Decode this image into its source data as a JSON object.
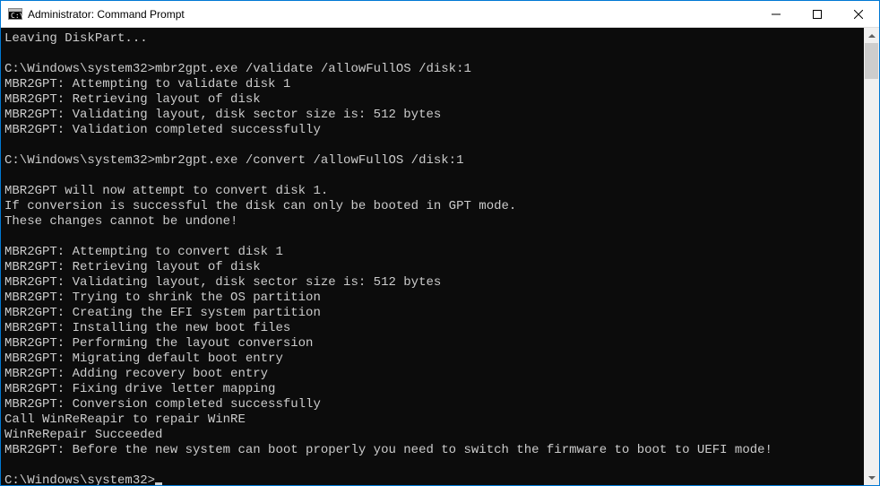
{
  "window": {
    "title": "Administrator: Command Prompt"
  },
  "terminal": {
    "lines": [
      "Leaving DiskPart...",
      "",
      "C:\\Windows\\system32>mbr2gpt.exe /validate /allowFullOS /disk:1",
      "MBR2GPT: Attempting to validate disk 1",
      "MBR2GPT: Retrieving layout of disk",
      "MBR2GPT: Validating layout, disk sector size is: 512 bytes",
      "MBR2GPT: Validation completed successfully",
      "",
      "C:\\Windows\\system32>mbr2gpt.exe /convert /allowFullOS /disk:1",
      "",
      "MBR2GPT will now attempt to convert disk 1.",
      "If conversion is successful the disk can only be booted in GPT mode.",
      "These changes cannot be undone!",
      "",
      "MBR2GPT: Attempting to convert disk 1",
      "MBR2GPT: Retrieving layout of disk",
      "MBR2GPT: Validating layout, disk sector size is: 512 bytes",
      "MBR2GPT: Trying to shrink the OS partition",
      "MBR2GPT: Creating the EFI system partition",
      "MBR2GPT: Installing the new boot files",
      "MBR2GPT: Performing the layout conversion",
      "MBR2GPT: Migrating default boot entry",
      "MBR2GPT: Adding recovery boot entry",
      "MBR2GPT: Fixing drive letter mapping",
      "MBR2GPT: Conversion completed successfully",
      "Call WinReReapir to repair WinRE",
      "WinReRepair Succeeded",
      "MBR2GPT: Before the new system can boot properly you need to switch the firmware to boot to UEFI mode!",
      ""
    ],
    "prompt": "C:\\Windows\\system32>"
  }
}
